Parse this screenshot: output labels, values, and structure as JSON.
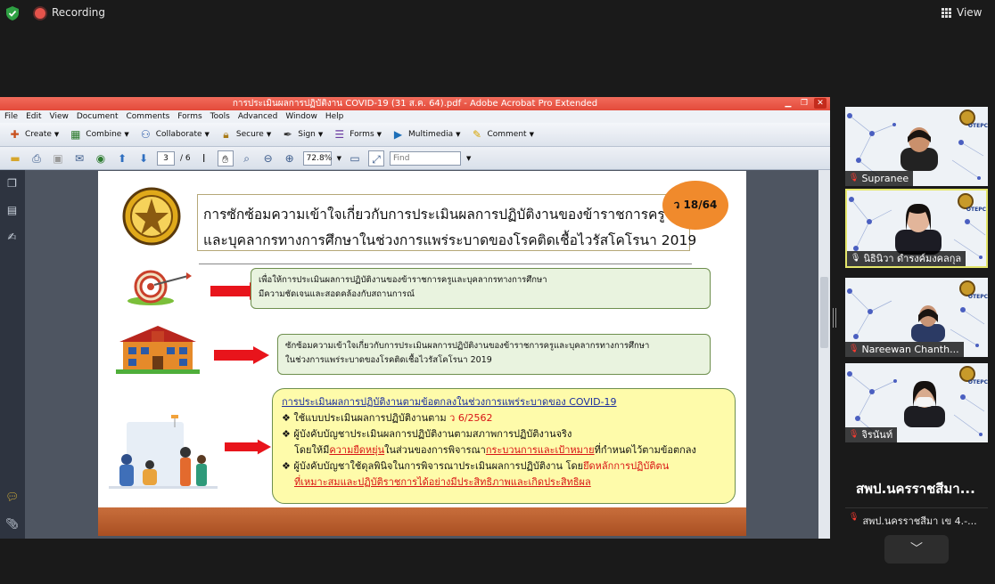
{
  "zoom": {
    "recording_label": "Recording",
    "view_label": "View",
    "colors": {
      "record": "#e5534b",
      "shield": "#2ea043",
      "active_speaker": "#e4e66a"
    }
  },
  "acrobat": {
    "title": "การประเมินผลการปฏิบัติงาน COVID-19 (31 ส.ค. 64).pdf - Adobe Acrobat Pro Extended",
    "menu": [
      "File",
      "Edit",
      "View",
      "Document",
      "Comments",
      "Forms",
      "Tools",
      "Advanced",
      "Window",
      "Help"
    ],
    "toolbar": [
      {
        "label": "Create",
        "icon": "create-icon"
      },
      {
        "label": "Combine",
        "icon": "combine-icon"
      },
      {
        "label": "Collaborate",
        "icon": "collaborate-icon"
      },
      {
        "label": "Secure",
        "icon": "lock-icon"
      },
      {
        "label": "Sign",
        "icon": "pen-icon"
      },
      {
        "label": "Forms",
        "icon": "forms-icon"
      },
      {
        "label": "Multimedia",
        "icon": "multimedia-icon"
      },
      {
        "label": "Comment",
        "icon": "comment-icon"
      }
    ],
    "page_current": "3",
    "page_total": "/ 6",
    "zoom_value": "72.8%",
    "find_placeholder": "Find"
  },
  "slide": {
    "badge": "ว 18/64",
    "title_line1": "การซักซ้อมความเข้าใจเกี่ยวกับการประเมินผลการปฏิบัติงานของข้าราชการครู",
    "title_line2": "และบุคลากรทางการศึกษาในช่วงการแพร่ระบาดของโรคติดเชื้อไวรัสโคโรนา 2019",
    "box1_line1": "เพื่อให้การประเมินผลการปฏิบัติงานของข้าราชการครูและบุคลากรทางการศึกษา",
    "box1_line2": "มีความชัดเจนและสอดคล้องกับสถานการณ์",
    "box2_line1": "ซักซ้อมความเข้าใจเกี่ยวกับการประเมินผลการปฏิบัติงานของข้าราชการครูและบุคลากรทางการศึกษา",
    "box2_line2": "ในช่วงการแพร่ระบาดของโรคติดเชื้อไวรัสโคโรนา 2019",
    "box3_head": "การประเมินผลการปฏิบัติงานตามข้อตกลงในช่วงการแพร่ระบาดของ COVID-19",
    "b1_prefix": "ใช้แบบประเมินผลการปฏิบัติงานตาม",
    "b1_red": "ว 6/2562",
    "b2_line1": "ผู้บังคับบัญชาประเมินผลการปฏิบัติงานตามสภาพการปฏิบัติงานจริง",
    "b2_l2_a": "โดยให้มี",
    "b2_l2_red1": "ความยืดหยุ่น",
    "b2_l2_b": "ในส่วนของการพิจารณา",
    "b2_l2_red2": "กระบวนการและเป้าหมาย",
    "b2_l2_c": "ที่กำหนดไว้ตามข้อตกลง",
    "b3_a": "ผู้บังคับบัญชาใช้ดุลพินิจในการพิจารณาประเมินผลการปฏิบัติงาน โดย",
    "b3_red1": "ยึดหลักการปฏิบัติตน",
    "b3_red2": "ที่เหมาะสมและปฏิบัติราชการได้อย่างมีประสิทธิภาพและเกิดประสิทธิผล",
    "colors": {
      "badge": "#f08a2c",
      "box": "#e9f3df",
      "highlight_box": "#fefbaa",
      "red": "#d91414",
      "head_blue": "#1b2e9e",
      "footer": "#b75a2a"
    }
  },
  "participants": [
    {
      "name": "Supranee"
    },
    {
      "name": "นิธินิวา ดำรงค์มงคลกุล"
    },
    {
      "name": "Nareewan Chanth..."
    },
    {
      "name": "จิรนันท์"
    }
  ],
  "side_panel": {
    "title": "สพป.นครราชสีมา...",
    "subtitle": "สพป.นครราชสีมา เข 4.-..."
  }
}
